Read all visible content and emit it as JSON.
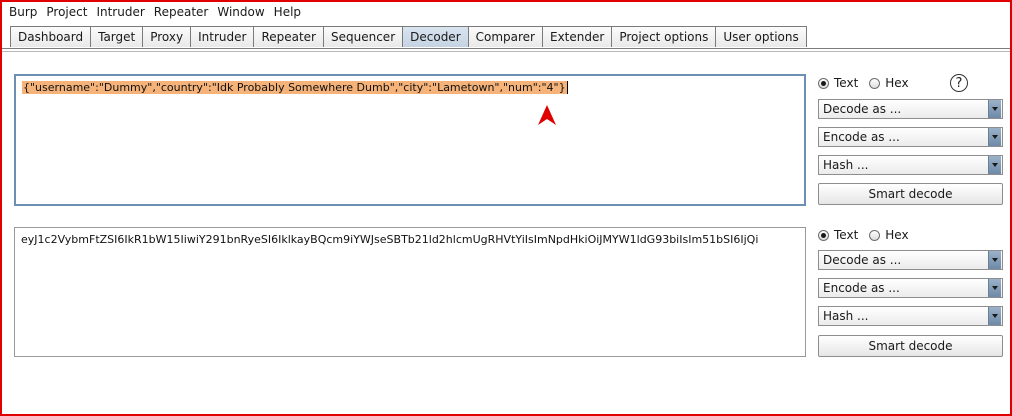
{
  "menu": [
    "Burp",
    "Project",
    "Intruder",
    "Repeater",
    "Window",
    "Help"
  ],
  "tabs": [
    {
      "label": "Dashboard",
      "active": false
    },
    {
      "label": "Target",
      "active": false
    },
    {
      "label": "Proxy",
      "active": false
    },
    {
      "label": "Intruder",
      "active": false
    },
    {
      "label": "Repeater",
      "active": false
    },
    {
      "label": "Sequencer",
      "active": false
    },
    {
      "label": "Decoder",
      "active": true
    },
    {
      "label": "Comparer",
      "active": false
    },
    {
      "label": "Extender",
      "active": false
    },
    {
      "label": "Project options",
      "active": false
    },
    {
      "label": "User options",
      "active": false
    }
  ],
  "panel1": {
    "text": "{\"username\":\"Dummy\",\"country\":\"Idk Probably Somewhere Dumb\",\"city\":\"Lametown\",\"num\":\"4\"}",
    "selection_color": "#f5b37a",
    "controls": {
      "text_label": "Text",
      "hex_label": "Hex",
      "selected": "Text",
      "help": "?",
      "decode_as": "Decode as ...",
      "encode_as": "Encode as ...",
      "hash": "Hash ...",
      "smart_decode": "Smart decode"
    }
  },
  "panel2": {
    "text": "eyJ1c2VybmFtZSI6IkR1bW15IiwiY291bnRyeSI6IklkayBQcm9iYWJseSBTb21ld2hlcmUgRHVtYiIsImNpdHkiOiJMYW1ldG93biIsIm51bSI6IjQi",
    "controls": {
      "text_label": "Text",
      "hex_label": "Hex",
      "selected": "Text",
      "decode_as": "Decode as ...",
      "encode_as": "Encode as ...",
      "hash": "Hash ...",
      "smart_decode": "Smart decode"
    }
  },
  "colors": {
    "frame_border": "#e00000",
    "active_tab": "#c4d3e3",
    "annotation_arrow": "#e00000"
  }
}
